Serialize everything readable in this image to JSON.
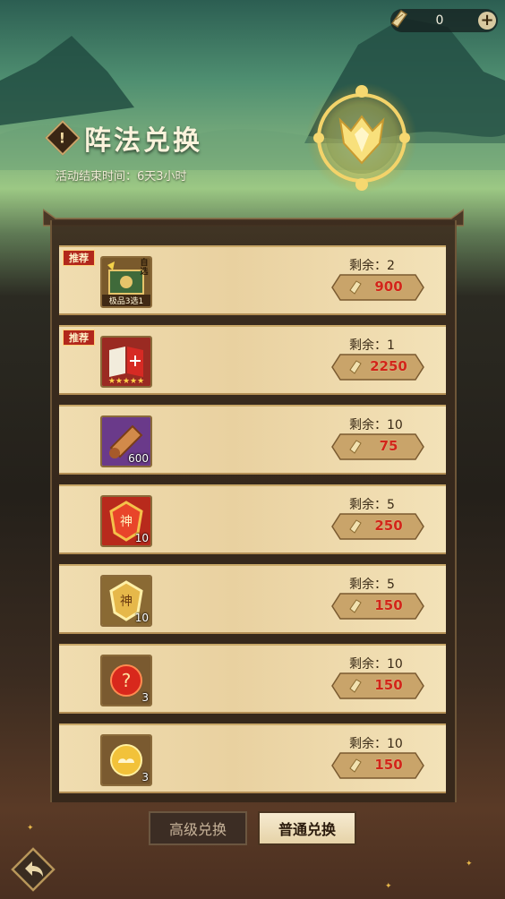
{
  "currency": {
    "value": "0",
    "plus": "+"
  },
  "header": {
    "title": "阵法兑换",
    "alert_glyph": "!",
    "end_time": "活动结束时间：6天3小时"
  },
  "items": [
    {
      "badge": "推荐",
      "icon": "chest-choice-icon",
      "corner": "自选",
      "sub": "极品3选1",
      "count": "",
      "remaining": "剩余：2",
      "price": "900"
    },
    {
      "badge": "推荐",
      "icon": "formation-book-icon",
      "corner": "",
      "sub": "★★★★★",
      "count": "",
      "remaining": "剩余：1",
      "price": "2250"
    },
    {
      "badge": "",
      "icon": "scroll-bundle-icon",
      "corner": "",
      "sub": "",
      "count": "600",
      "remaining": "剩余：10",
      "price": "75"
    },
    {
      "badge": "",
      "icon": "red-divine-token-icon",
      "corner": "",
      "sub": "",
      "count": "10",
      "remaining": "剩余：5",
      "price": "250"
    },
    {
      "badge": "",
      "icon": "gold-divine-token-icon",
      "corner": "",
      "sub": "",
      "count": "10",
      "remaining": "剩余：5",
      "price": "150"
    },
    {
      "badge": "",
      "icon": "red-mystery-orb-icon",
      "corner": "",
      "sub": "",
      "count": "3",
      "remaining": "剩余：10",
      "price": "150"
    },
    {
      "badge": "",
      "icon": "gold-cloud-orb-icon",
      "corner": "",
      "sub": "",
      "count": "3",
      "remaining": "剩余：10",
      "price": "150"
    }
  ],
  "tabs": {
    "advanced": "高级兑换",
    "normal": "普通兑换"
  },
  "colors": {
    "price_red": "#d1251a",
    "badge_red": "#b2281c",
    "row_bg": "#f0ddb0"
  }
}
